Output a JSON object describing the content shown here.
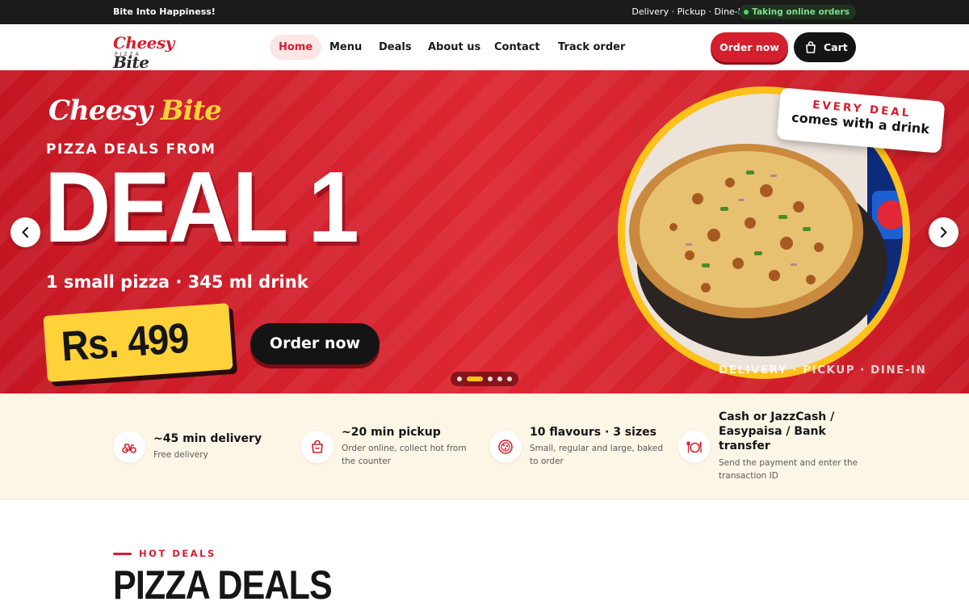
{
  "topbar": {
    "tagline": "Bite Into Happiness!",
    "services": "Delivery · Pickup · Dine-In",
    "status": "Taking online orders"
  },
  "header": {
    "logo_word_1": "Cheesy",
    "logo_word_2": "Bite",
    "logo_sub": "PIZZA",
    "nav": [
      {
        "label": "Home",
        "active": true
      },
      {
        "label": "Menu",
        "active": false
      },
      {
        "label": "Deals",
        "active": false
      },
      {
        "label": "About us",
        "active": false
      },
      {
        "label": "Contact",
        "active": false
      },
      {
        "label": "Track order",
        "active": false
      }
    ],
    "order_button": "Order now",
    "cart_button": "Cart"
  },
  "hero": {
    "brand_1": "Cheesy",
    "brand_2": "Bite",
    "kicker": "PIZZA DEALS FROM",
    "title": "DEAL 1",
    "subtitle": "1 small pizza · 345 ml drink",
    "price": "Rs. 499",
    "order_button": "Order now",
    "badge_line_1": "EVERY DEAL",
    "badge_line_2": "comes with a drink",
    "caption": "DELIVERY · PICKUP · DINE-IN",
    "slides_count": 5,
    "active_slide": 2
  },
  "features": [
    {
      "icon": "scooter-icon",
      "title": "~45 min delivery",
      "desc": "Free delivery"
    },
    {
      "icon": "shopping-bag-icon",
      "title": "~20 min pickup",
      "desc": "Order online, collect hot from the counter"
    },
    {
      "icon": "pizza-icon",
      "title": "10 flavours · 3 sizes",
      "desc": "Small, regular and large, baked to order"
    },
    {
      "icon": "plate-icon",
      "title": "Cash or JazzCash / Easypaisa / Bank transfer",
      "desc": "Send the payment and enter the transaction ID"
    }
  ],
  "deals_section": {
    "kicker": "HOT DEALS",
    "title": "PIZZA DEALS"
  },
  "colors": {
    "brand_red": "#d41f2e",
    "accent_yellow": "#ffd23a",
    "dark": "#141414",
    "cream": "#fdf5e6"
  }
}
